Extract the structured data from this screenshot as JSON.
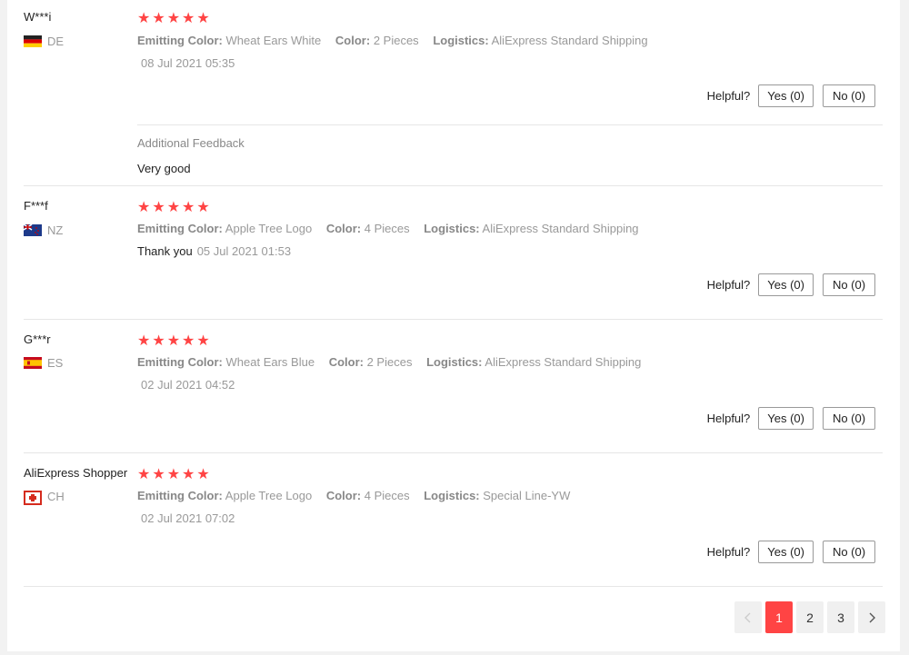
{
  "labels": {
    "emitting_color": "Emitting Color:",
    "color": "Color:",
    "logistics": "Logistics:",
    "helpful": "Helpful?",
    "additional_feedback": "Additional Feedback"
  },
  "reviews": [
    {
      "user": "W***i",
      "country": "DE",
      "rating": 5,
      "emitting_color": "Wheat Ears White",
      "color": "2 Pieces",
      "logistics": "AliExpress Standard Shipping",
      "feedback": "",
      "date": "08 Jul 2021 05:35",
      "yes": "Yes (0)",
      "no": "No (0)",
      "additional_feedback": "Very good"
    },
    {
      "user": "F***f",
      "country": "NZ",
      "rating": 5,
      "emitting_color": "Apple Tree Logo",
      "color": "4 Pieces",
      "logistics": "AliExpress Standard Shipping",
      "feedback": "Thank you",
      "date": "05 Jul 2021 01:53",
      "yes": "Yes (0)",
      "no": "No (0)"
    },
    {
      "user": "G***r",
      "country": "ES",
      "rating": 5,
      "emitting_color": "Wheat Ears Blue",
      "color": "2 Pieces",
      "logistics": "AliExpress Standard Shipping",
      "feedback": "",
      "date": "02 Jul 2021 04:52",
      "yes": "Yes (0)",
      "no": "No (0)"
    },
    {
      "user": "AliExpress Shopper",
      "country": "CH",
      "rating": 5,
      "emitting_color": "Apple Tree Logo",
      "color": "4 Pieces",
      "logistics": "Special Line-YW",
      "feedback": "",
      "date": "02 Jul 2021 07:02",
      "yes": "Yes (0)",
      "no": "No (0)"
    }
  ],
  "pagination": {
    "prev_icon": "chevron-left-icon",
    "next_icon": "chevron-right-icon",
    "pages": [
      "1",
      "2",
      "3"
    ],
    "current": "1"
  },
  "colors": {
    "accent": "#ff4747",
    "star": "#ff4747"
  }
}
